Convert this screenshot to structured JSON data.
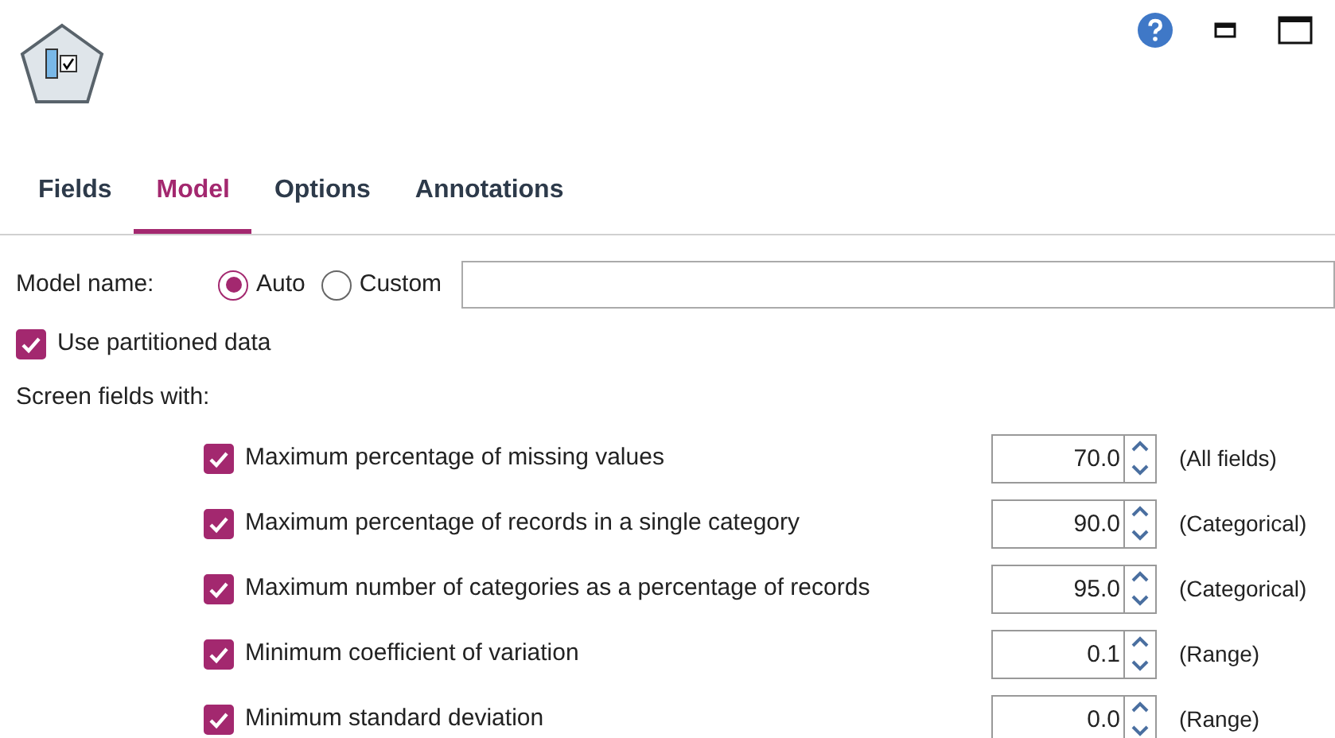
{
  "tabs": [
    {
      "label": "Fields",
      "selected": false
    },
    {
      "label": "Model",
      "selected": true
    },
    {
      "label": "Options",
      "selected": false
    },
    {
      "label": "Annotations",
      "selected": false
    }
  ],
  "model_name": {
    "label": "Model name:",
    "options": [
      {
        "label": "Auto",
        "selected": true
      },
      {
        "label": "Custom",
        "selected": false
      }
    ]
  },
  "use_partitioned_data": {
    "label": "Use partitioned data",
    "checked": true
  },
  "screen_fields": {
    "label": "Screen fields with:",
    "rows": [
      {
        "label": "Maximum percentage of missing values",
        "checked": true,
        "value": "70.0",
        "scope": "(All fields)"
      },
      {
        "label": "Maximum percentage of records in a single category",
        "checked": true,
        "value": "90.0",
        "scope": "(Categorical)"
      },
      {
        "label": "Maximum number of categories as a percentage of records",
        "checked": true,
        "value": "95.0",
        "scope": "(Categorical)"
      },
      {
        "label": "Minimum coefficient of variation",
        "checked": true,
        "value": "0.1",
        "scope": "(Range)"
      },
      {
        "label": "Minimum standard deviation",
        "checked": true,
        "value": "0.0",
        "scope": "(Range)"
      }
    ]
  }
}
